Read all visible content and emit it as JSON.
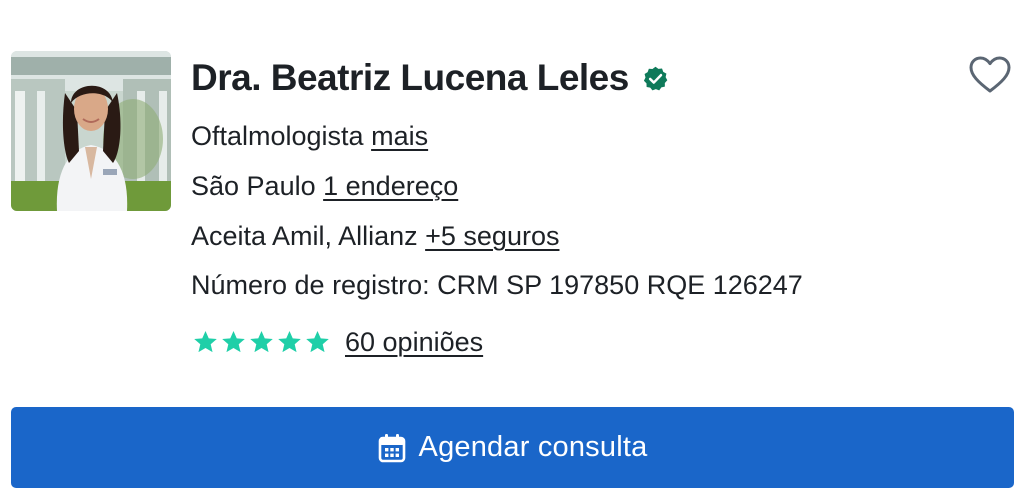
{
  "doctor": {
    "name": "Dra. Beatriz Lucena Leles",
    "verified_icon": "verified-check-icon",
    "verified_color": "#0f7a5a",
    "photo_icon": "doctor-portrait-photo"
  },
  "favorite": {
    "icon": "heart-outline-icon"
  },
  "specialty": {
    "text": "Oftalmologista",
    "link": "mais"
  },
  "location": {
    "text": "São Paulo",
    "link": "1 endereço"
  },
  "insurance": {
    "text": "Aceita Amil, Allianz",
    "link": "+5 seguros"
  },
  "registration": {
    "text": "Número de registro: CRM SP 197850 RQE 126247"
  },
  "rating": {
    "stars": 5,
    "max_stars": 5,
    "star_color": "#1fcfa8",
    "reviews_link": "60 opiniões"
  },
  "cta": {
    "label": "Agendar consulta",
    "icon": "calendar-icon",
    "background": "#1a66c9"
  }
}
